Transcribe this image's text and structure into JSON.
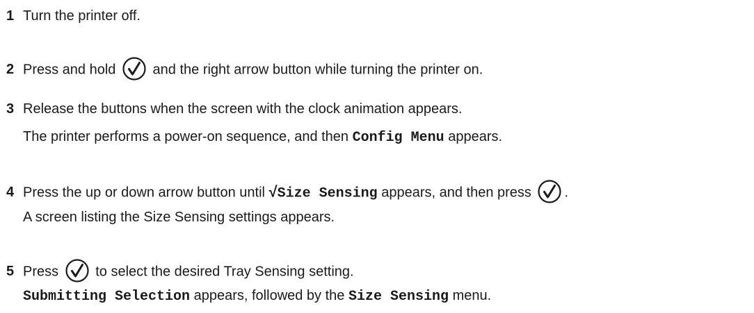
{
  "steps": [
    {
      "number": "1",
      "text": "Turn the printer off."
    },
    {
      "number": "2",
      "text_before": "Press and hold",
      "icon": "select-check-button-icon",
      "text_after": "and the right arrow button while turning the printer on."
    },
    {
      "number": "3",
      "text": "Release the buttons when the screen with the clock animation appears.",
      "sub_before": "The printer performs a power-on sequence, and then",
      "sub_code": "Config Menu",
      "sub_after": "appears."
    },
    {
      "number": "4",
      "text_before": "Press the up or down arrow button until",
      "check_glyph": "√",
      "code": "Size Sensing",
      "text_middle": "appears, and then press",
      "icon": "select-check-button-icon",
      "text_end": ".",
      "sub": "A screen listing the Size Sensing settings appears."
    },
    {
      "number": "5",
      "text_before": "Press",
      "icon": "select-check-button-icon",
      "text_after": "to select the desired Tray Sensing setting.",
      "sub_code1": "Submitting Selection",
      "sub_mid": "appears, followed by the",
      "sub_code2": "Size Sensing",
      "sub_after": "menu."
    }
  ]
}
